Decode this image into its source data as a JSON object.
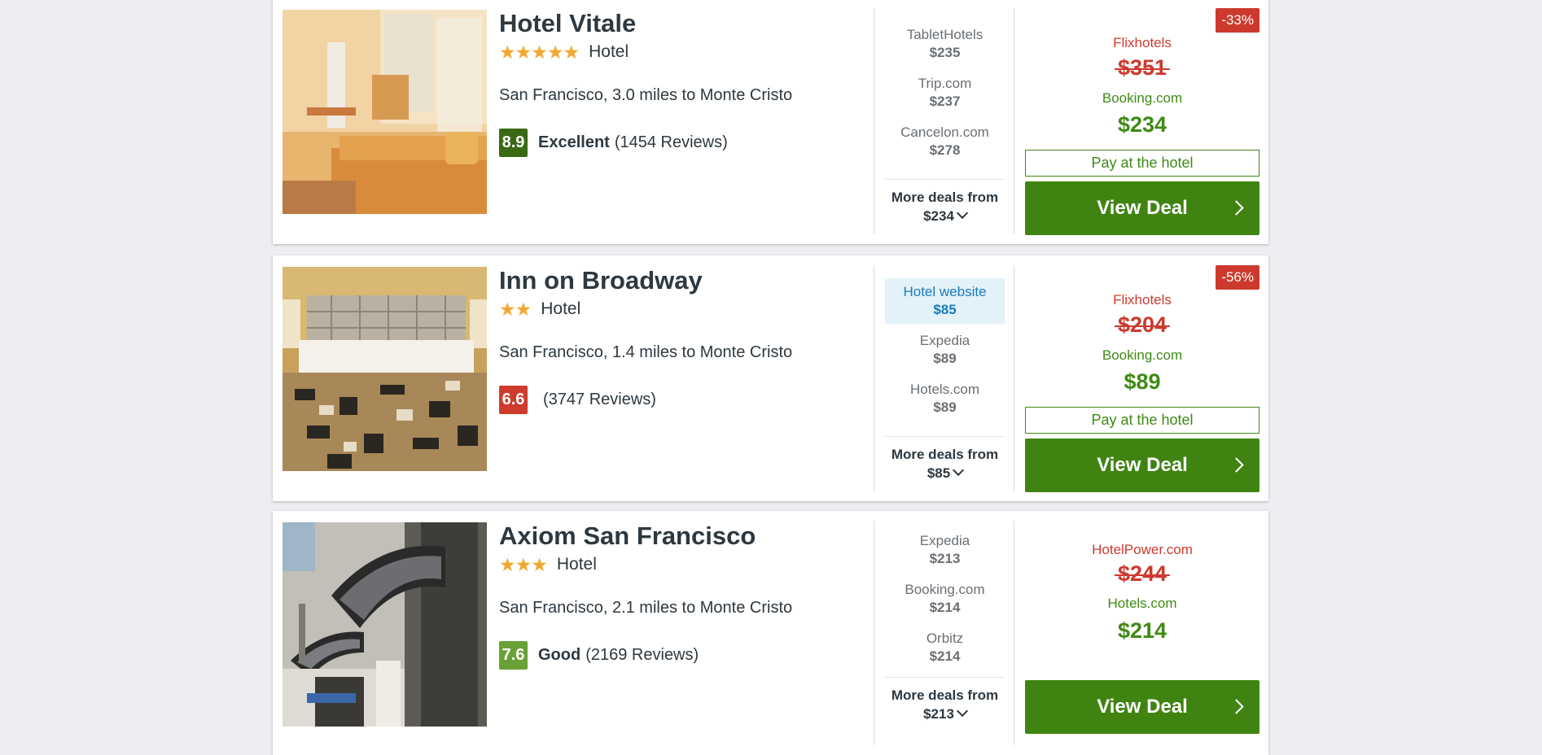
{
  "hotels": [
    {
      "name": "Hotel Vitale",
      "stars": "★★★★★",
      "type": "Hotel",
      "location": "San Francisco, 3.0 miles to Monte Cristo",
      "score": "8.9",
      "score_color": "#3a6914",
      "rating_word": "Excellent",
      "reviews": "(1454 Reviews)",
      "deals": [
        {
          "provider": "TabletHotels",
          "price": "$235"
        },
        {
          "provider": "Trip.com",
          "price": "$237"
        },
        {
          "provider": "Cancelon.com",
          "price": "$278"
        }
      ],
      "more_label": "More deals from",
      "more_price": "$234",
      "badge": "-33%",
      "old_provider": "Flixhotels",
      "old_price": "$351",
      "new_provider": "Booking.com",
      "new_price": "$234",
      "pay_label": "Pay at the hotel",
      "cta": "View Deal"
    },
    {
      "name": "Inn on Broadway",
      "stars": "★★",
      "type": "Hotel",
      "location": "San Francisco, 1.4 miles to Monte Cristo",
      "score": "6.6",
      "score_color": "#cf3b2c",
      "rating_word": "",
      "reviews": "(3747 Reviews)",
      "deals": [
        {
          "provider": "Hotel website",
          "price": "$85",
          "highlight": true
        },
        {
          "provider": "Expedia",
          "price": "$89"
        },
        {
          "provider": "Hotels.com",
          "price": "$89"
        }
      ],
      "more_label": "More deals from",
      "more_price": "$85",
      "badge": "-56%",
      "old_provider": "Flixhotels",
      "old_price": "$204",
      "new_provider": "Booking.com",
      "new_price": "$89",
      "pay_label": "Pay at the hotel",
      "cta": "View Deal"
    },
    {
      "name": "Axiom San Francisco",
      "stars": "★★★",
      "type": "Hotel",
      "location": "San Francisco, 2.1 miles to Monte Cristo",
      "score": "7.6",
      "score_color": "#6aa136",
      "rating_word": "Good",
      "reviews": "(2169 Reviews)",
      "deals": [
        {
          "provider": "Expedia",
          "price": "$213"
        },
        {
          "provider": "Booking.com",
          "price": "$214"
        },
        {
          "provider": "Orbitz",
          "price": "$214"
        }
      ],
      "more_label": "More deals from",
      "more_price": "$213",
      "old_provider": "HotelPower.com",
      "old_price": "$244",
      "new_provider": "Hotels.com",
      "new_price": "$214",
      "cta": "View Deal"
    }
  ]
}
